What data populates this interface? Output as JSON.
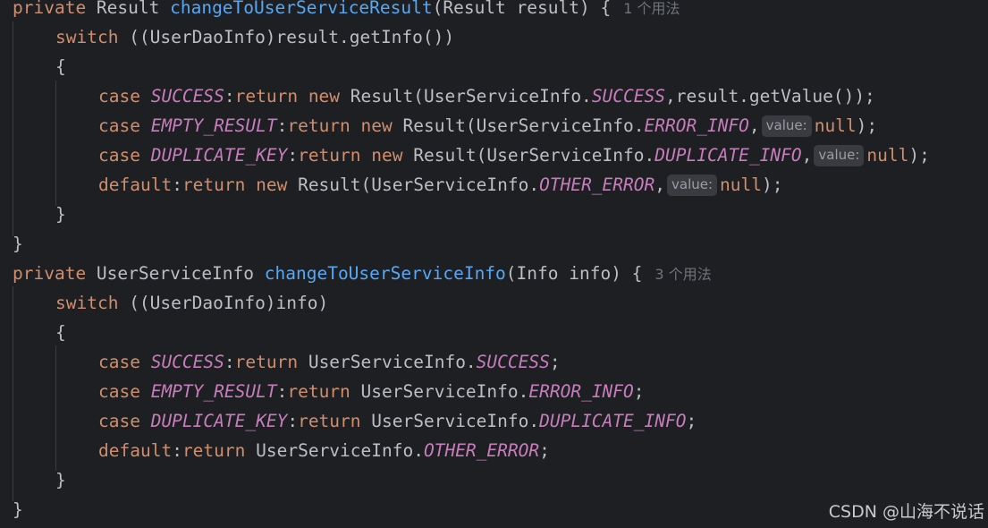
{
  "lines": [
    {
      "indent": 0,
      "tokens": [
        {
          "t": "private ",
          "c": "kw"
        },
        {
          "t": "Result ",
          "c": "plain"
        },
        {
          "t": "changeToUserServiceResult",
          "c": "fn"
        },
        {
          "t": "(Result result) {",
          "c": "plain"
        },
        {
          "t": "1 个用法",
          "c": "usage"
        }
      ]
    },
    {
      "indent": 1,
      "tokens": [
        {
          "t": "switch ",
          "c": "kw"
        },
        {
          "t": "((UserDaoInfo)result.getInfo())",
          "c": "plain"
        }
      ]
    },
    {
      "indent": 1,
      "tokens": [
        {
          "t": "{",
          "c": "plain"
        }
      ]
    },
    {
      "indent": 2,
      "tokens": [
        {
          "t": "case ",
          "c": "kw"
        },
        {
          "t": "SUCCESS",
          "c": "const"
        },
        {
          "t": ":",
          "c": "plain"
        },
        {
          "t": "return new ",
          "c": "kw"
        },
        {
          "t": "Result(UserServiceInfo.",
          "c": "plain"
        },
        {
          "t": "SUCCESS",
          "c": "const"
        },
        {
          "t": ",result.getValue());",
          "c": "plain"
        }
      ]
    },
    {
      "indent": 2,
      "tokens": [
        {
          "t": "case ",
          "c": "kw"
        },
        {
          "t": "EMPTY_RESULT",
          "c": "const"
        },
        {
          "t": ":",
          "c": "plain"
        },
        {
          "t": "return new ",
          "c": "kw"
        },
        {
          "t": "Result(UserServiceInfo.",
          "c": "plain"
        },
        {
          "t": "ERROR_INFO",
          "c": "const"
        },
        {
          "t": ",",
          "c": "plain"
        },
        {
          "t": "value:",
          "c": "hint"
        },
        {
          "t": "null",
          "c": "kw"
        },
        {
          "t": ");",
          "c": "plain"
        }
      ]
    },
    {
      "indent": 2,
      "tokens": [
        {
          "t": "case ",
          "c": "kw"
        },
        {
          "t": "DUPLICATE_KEY",
          "c": "const"
        },
        {
          "t": ":",
          "c": "plain"
        },
        {
          "t": "return new ",
          "c": "kw"
        },
        {
          "t": "Result(UserServiceInfo.",
          "c": "plain"
        },
        {
          "t": "DUPLICATE_INFO",
          "c": "const"
        },
        {
          "t": ",",
          "c": "plain"
        },
        {
          "t": "value:",
          "c": "hint"
        },
        {
          "t": "null",
          "c": "kw"
        },
        {
          "t": ");",
          "c": "plain"
        }
      ]
    },
    {
      "indent": 2,
      "tokens": [
        {
          "t": "default",
          "c": "kw"
        },
        {
          "t": ":",
          "c": "plain"
        },
        {
          "t": "return new ",
          "c": "kw"
        },
        {
          "t": "Result(UserServiceInfo.",
          "c": "plain"
        },
        {
          "t": "OTHER_ERROR",
          "c": "const"
        },
        {
          "t": ",",
          "c": "plain"
        },
        {
          "t": "value:",
          "c": "hint"
        },
        {
          "t": "null",
          "c": "kw"
        },
        {
          "t": ");",
          "c": "plain"
        }
      ]
    },
    {
      "indent": 1,
      "tokens": [
        {
          "t": "}",
          "c": "plain"
        }
      ]
    },
    {
      "indent": 0,
      "tokens": [
        {
          "t": "}",
          "c": "plain"
        }
      ]
    },
    {
      "indent": 0,
      "tokens": [
        {
          "t": "private ",
          "c": "kw"
        },
        {
          "t": "UserServiceInfo ",
          "c": "plain"
        },
        {
          "t": "changeToUserServiceInfo",
          "c": "fn"
        },
        {
          "t": "(Info info) {",
          "c": "plain"
        },
        {
          "t": "3 个用法",
          "c": "usage"
        }
      ]
    },
    {
      "indent": 1,
      "tokens": [
        {
          "t": "switch ",
          "c": "kw"
        },
        {
          "t": "((UserDaoInfo)info)",
          "c": "plain"
        }
      ]
    },
    {
      "indent": 1,
      "tokens": [
        {
          "t": "{",
          "c": "plain"
        }
      ]
    },
    {
      "indent": 2,
      "tokens": [
        {
          "t": "case ",
          "c": "kw"
        },
        {
          "t": "SUCCESS",
          "c": "const"
        },
        {
          "t": ":",
          "c": "plain"
        },
        {
          "t": "return ",
          "c": "kw"
        },
        {
          "t": "UserServiceInfo.",
          "c": "plain"
        },
        {
          "t": "SUCCESS",
          "c": "const"
        },
        {
          "t": ";",
          "c": "plain"
        }
      ]
    },
    {
      "indent": 2,
      "tokens": [
        {
          "t": "case ",
          "c": "kw"
        },
        {
          "t": "EMPTY_RESULT",
          "c": "const"
        },
        {
          "t": ":",
          "c": "plain"
        },
        {
          "t": "return ",
          "c": "kw"
        },
        {
          "t": "UserServiceInfo.",
          "c": "plain"
        },
        {
          "t": "ERROR_INFO",
          "c": "const"
        },
        {
          "t": ";",
          "c": "plain"
        }
      ]
    },
    {
      "indent": 2,
      "tokens": [
        {
          "t": "case ",
          "c": "kw"
        },
        {
          "t": "DUPLICATE_KEY",
          "c": "const"
        },
        {
          "t": ":",
          "c": "plain"
        },
        {
          "t": "return ",
          "c": "kw"
        },
        {
          "t": "UserServiceInfo.",
          "c": "plain"
        },
        {
          "t": "DUPLICATE_INFO",
          "c": "const"
        },
        {
          "t": ";",
          "c": "plain"
        }
      ]
    },
    {
      "indent": 2,
      "tokens": [
        {
          "t": "default",
          "c": "kw"
        },
        {
          "t": ":",
          "c": "plain"
        },
        {
          "t": "return ",
          "c": "kw"
        },
        {
          "t": "UserServiceInfo.",
          "c": "plain"
        },
        {
          "t": "OTHER_ERROR",
          "c": "const"
        },
        {
          "t": ";",
          "c": "plain"
        }
      ]
    },
    {
      "indent": 1,
      "tokens": [
        {
          "t": "}",
          "c": "plain"
        }
      ]
    },
    {
      "indent": 0,
      "tokens": [
        {
          "t": "}",
          "c": "plain"
        }
      ]
    }
  ],
  "watermark": "CSDN @山海不说话",
  "colors": {
    "background": "#1e1f22",
    "keyword": "#cf8e6d",
    "method": "#56a8f5",
    "constant": "#c77dbb",
    "text": "#bcbec4",
    "hint_bg": "#393b40",
    "usage": "#6f737a"
  }
}
